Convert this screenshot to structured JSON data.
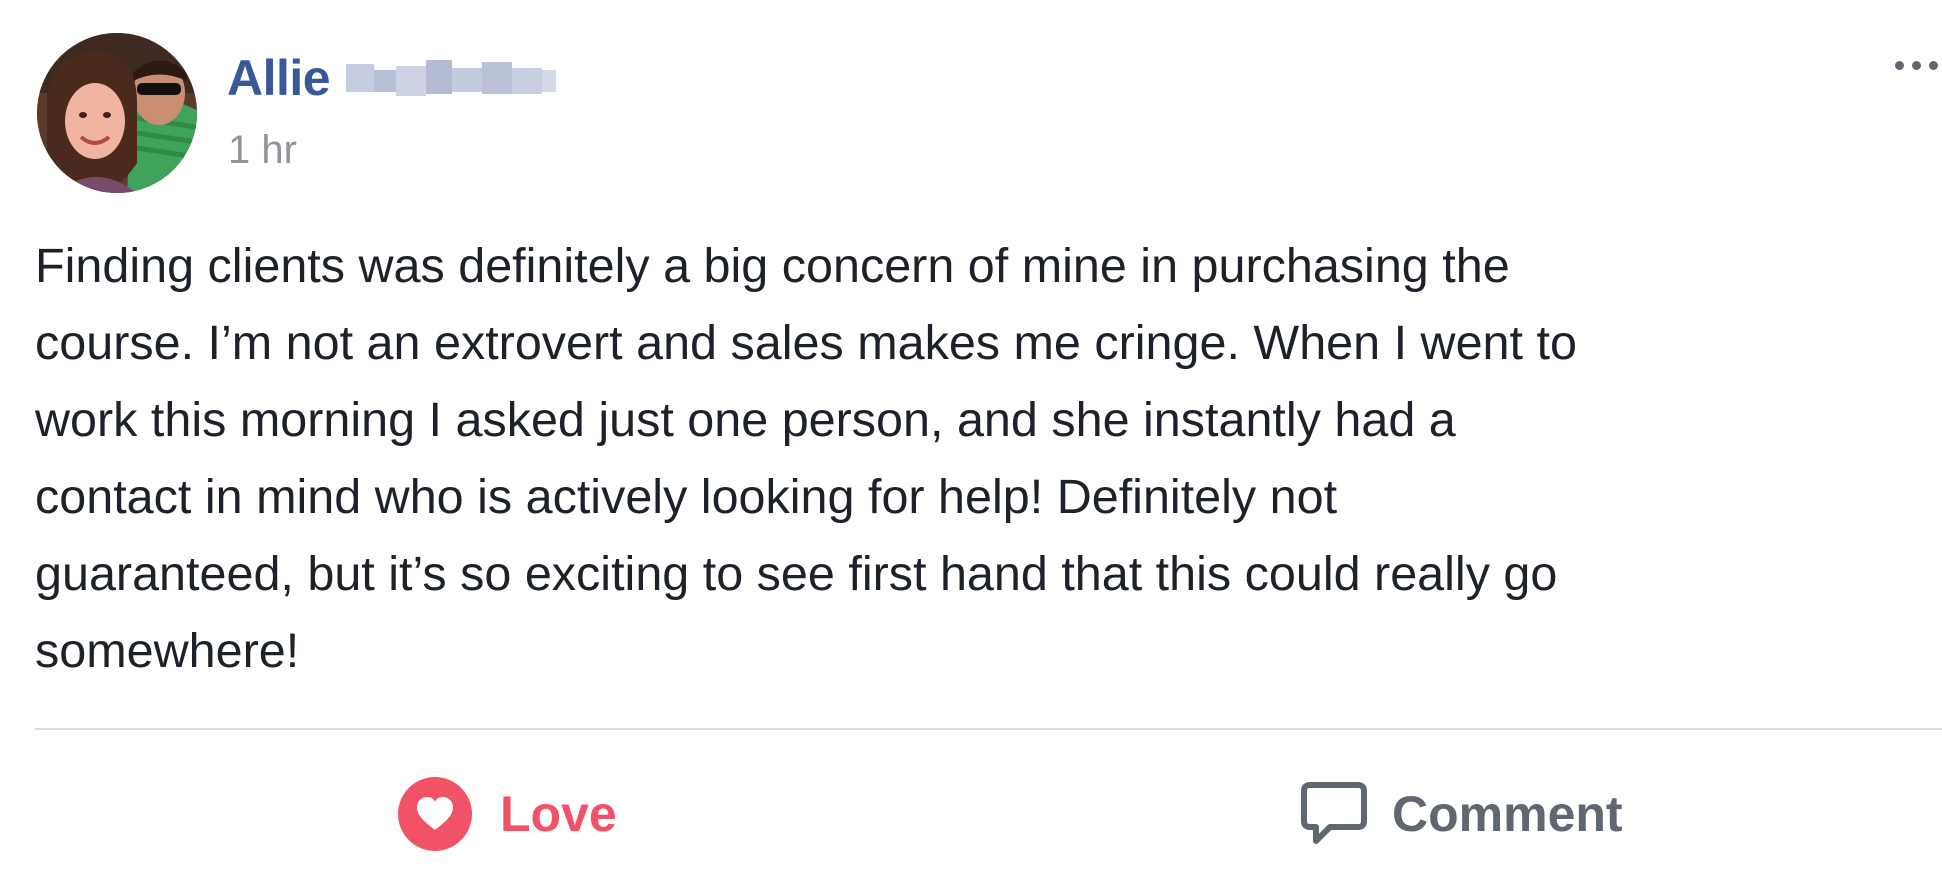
{
  "post": {
    "author": {
      "first_name": "Allie",
      "surname_redacted": true,
      "avatar_icon": "profile-photo"
    },
    "timestamp": "1 hr",
    "more_icon": "more-options-icon",
    "body": "Finding clients was definitely a big concern of mine in purchasing the\ncourse. I’m not an extrovert and sales makes me cringe. When I went to\nwork this morning I asked just one person, and she instantly had a\ncontact in mind who is actively looking for help! Definitely not\nguaranteed, but it’s so exciting to see first hand that this could really go\nsomewhere!",
    "actions": {
      "love": {
        "label": "Love",
        "icon": "heart-icon",
        "color": "#f25268"
      },
      "comment": {
        "label": "Comment",
        "icon": "speech-bubble-icon",
        "color": "#606770"
      }
    }
  },
  "colors": {
    "author_name": "#385898",
    "timestamp": "#90949c",
    "body_text": "#1d2129",
    "divider": "#dadde1"
  }
}
